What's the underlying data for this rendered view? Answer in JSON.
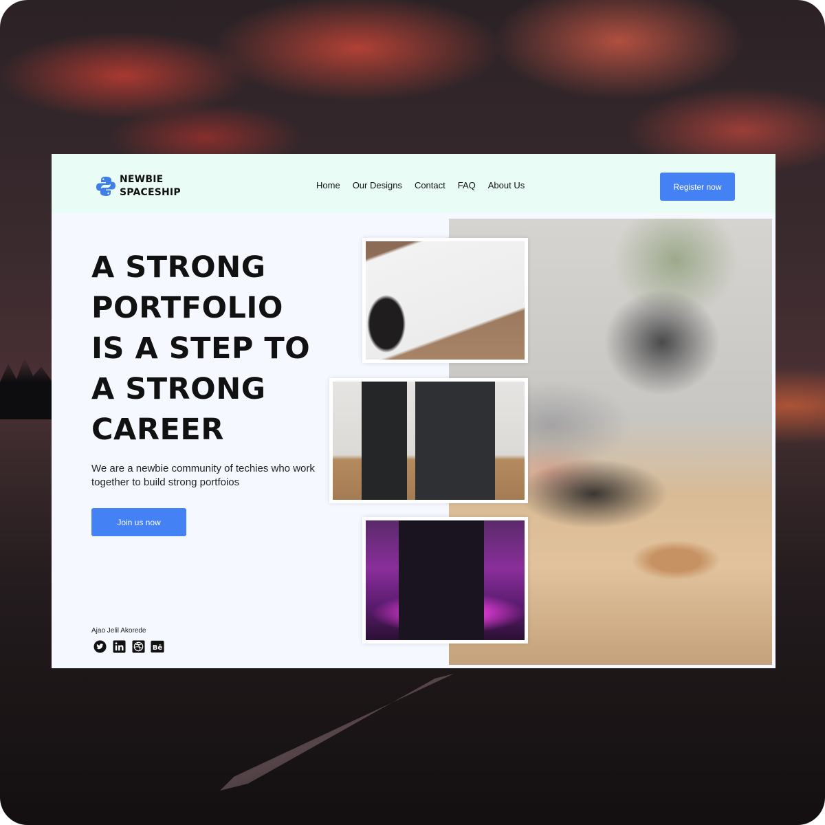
{
  "logo": {
    "line1": "NEWBIE",
    "line2": "SPACESHIP",
    "icon": "python-icon"
  },
  "nav": {
    "items": [
      {
        "label": "Home"
      },
      {
        "label": "Our Designs"
      },
      {
        "label": "Contact"
      },
      {
        "label": "FAQ"
      },
      {
        "label": "About Us"
      }
    ],
    "register_label": "Register now"
  },
  "hero": {
    "title_lines": [
      "A STRONG",
      "PORTFOLIO",
      "IS A STEP TO",
      "A STRONG",
      "CAREER"
    ],
    "subtitle": "We are a newbie community of techies who work together to build strong portfoios",
    "join_label": "Join us now"
  },
  "footer": {
    "author": "Ajao Jelil Akorede",
    "socials": [
      "twitter-icon",
      "linkedin-icon",
      "dribbble-icon",
      "behance-icon"
    ]
  },
  "colors": {
    "accent": "#4481f5",
    "navbar_bg": "#eafcf6",
    "page_bg": "#f5f8ff"
  }
}
